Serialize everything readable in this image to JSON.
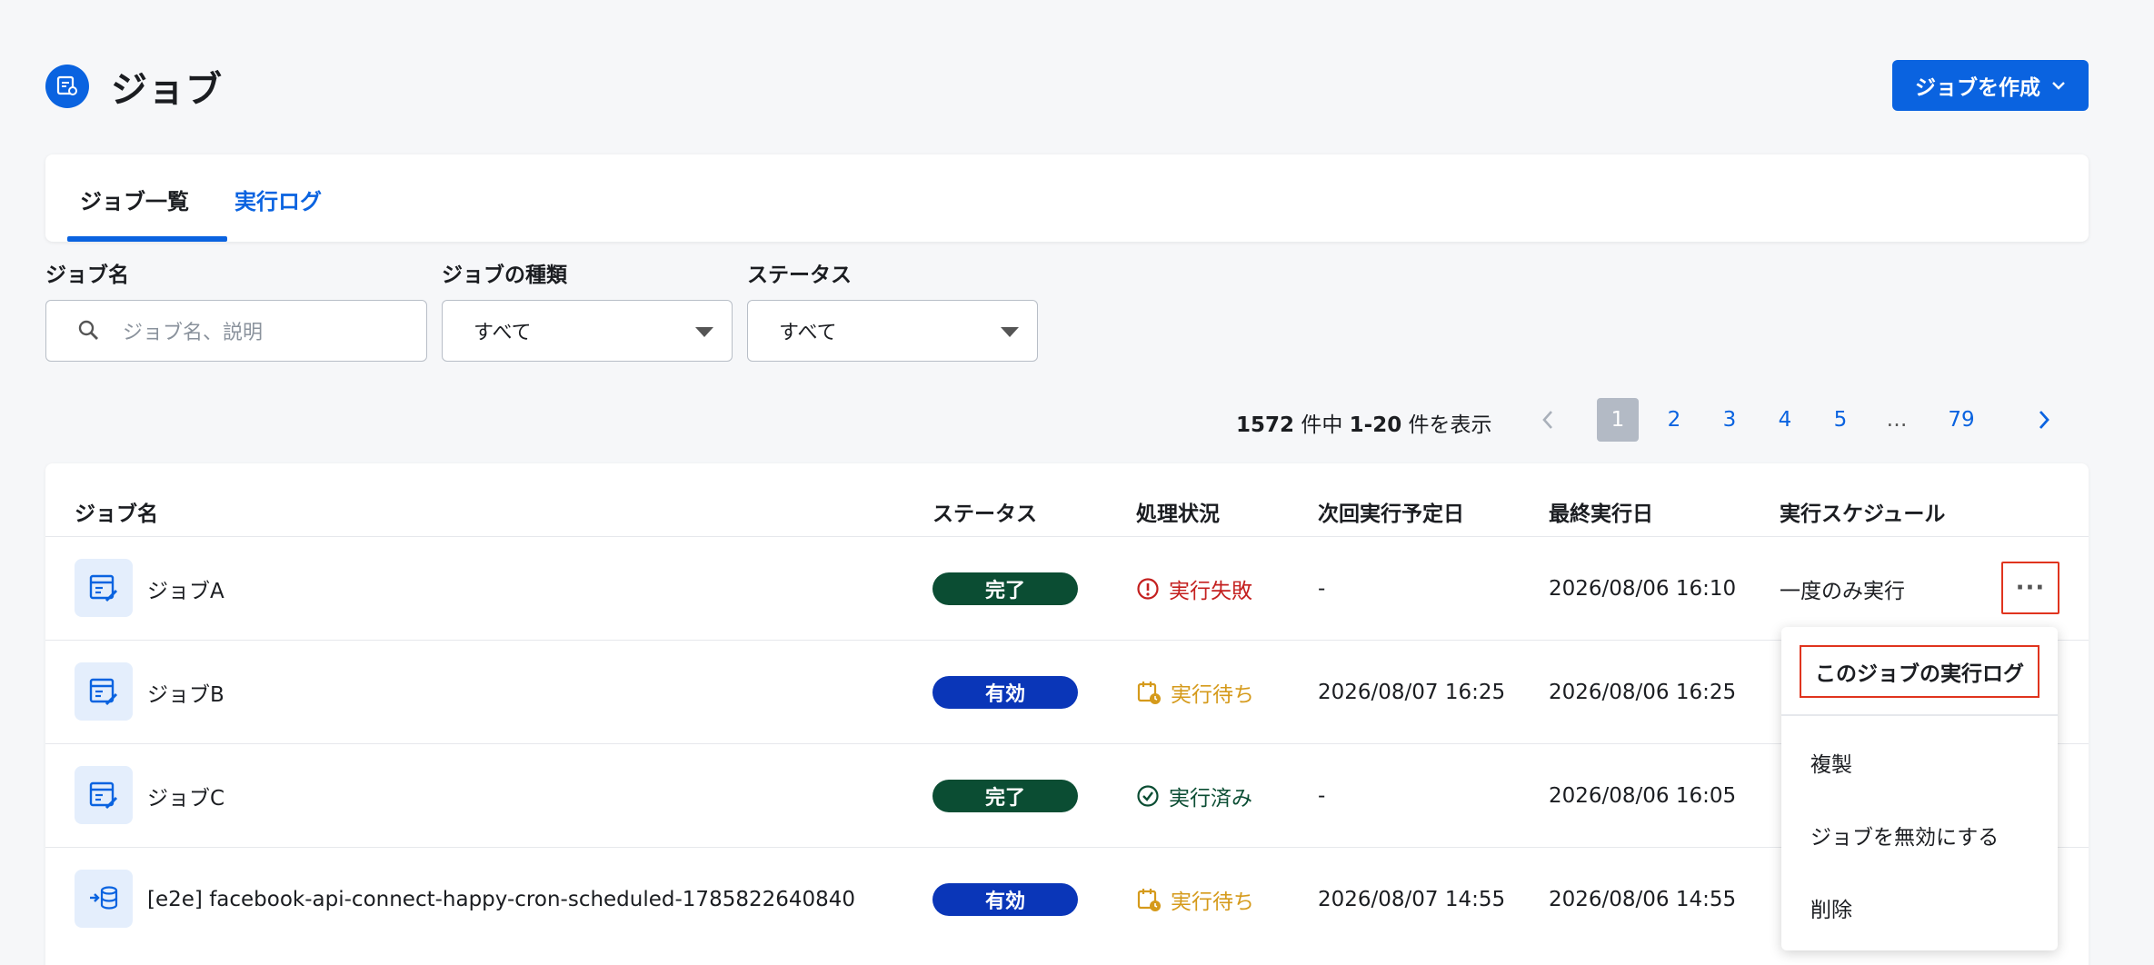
{
  "header": {
    "title": "ジョブ",
    "create_button": "ジョブを作成"
  },
  "tabs": [
    {
      "label": "ジョブ一覧",
      "active": true
    },
    {
      "label": "実行ログ",
      "active": false
    }
  ],
  "filters": {
    "job_name": {
      "label": "ジョブ名",
      "placeholder": "ジョブ名、説明"
    },
    "job_type": {
      "label": "ジョブの種類",
      "value": "すべて"
    },
    "status": {
      "label": "ステータス",
      "value": "すべて"
    }
  },
  "pagination": {
    "total": "1572",
    "range": "1-20",
    "text_mid": " 件中 ",
    "text_end": " 件を表示",
    "pages": [
      "1",
      "2",
      "3",
      "4",
      "5",
      "…",
      "79"
    ],
    "current": "1"
  },
  "table": {
    "headers": [
      "ジョブ名",
      "ステータス",
      "処理状況",
      "次回実行予定日",
      "最終実行日",
      "実行スケジュール"
    ],
    "rows": [
      {
        "name": "ジョブA",
        "status": "完了",
        "status_kind": "done",
        "proc": "実行失敗",
        "proc_kind": "fail",
        "next": "-",
        "last": "2026/08/06 16:10",
        "schedule": "一度のみ実行",
        "icon": "table-edit-icon"
      },
      {
        "name": "ジョブB",
        "status": "有効",
        "status_kind": "active",
        "proc": "実行待ち",
        "proc_kind": "wait",
        "next": "2026/08/07 16:25",
        "last": "2026/08/06 16:25",
        "schedule": "",
        "icon": "table-edit-icon"
      },
      {
        "name": "ジョブC",
        "status": "完了",
        "status_kind": "done",
        "proc": "実行済み",
        "proc_kind": "ok",
        "next": "-",
        "last": "2026/08/06 16:05",
        "schedule": "",
        "icon": "table-edit-icon"
      },
      {
        "name": "[e2e] facebook-api-connect-happy-cron-scheduled-1785822640840",
        "status": "有効",
        "status_kind": "active",
        "proc": "実行待ち",
        "proc_kind": "wait",
        "next": "2026/08/07 14:55",
        "last": "2026/08/06 14:55",
        "schedule": "",
        "icon": "database-import-icon"
      }
    ]
  },
  "context_menu": {
    "items": [
      "このジョブの実行ログ",
      "複製",
      "ジョブを無効にする",
      "削除"
    ]
  },
  "colors": {
    "primary": "#0a63e0",
    "done": "#0b4d33",
    "active": "#0a36b8",
    "fail": "#c4201f",
    "wait": "#d59a1b",
    "highlight": "#e0341e"
  }
}
